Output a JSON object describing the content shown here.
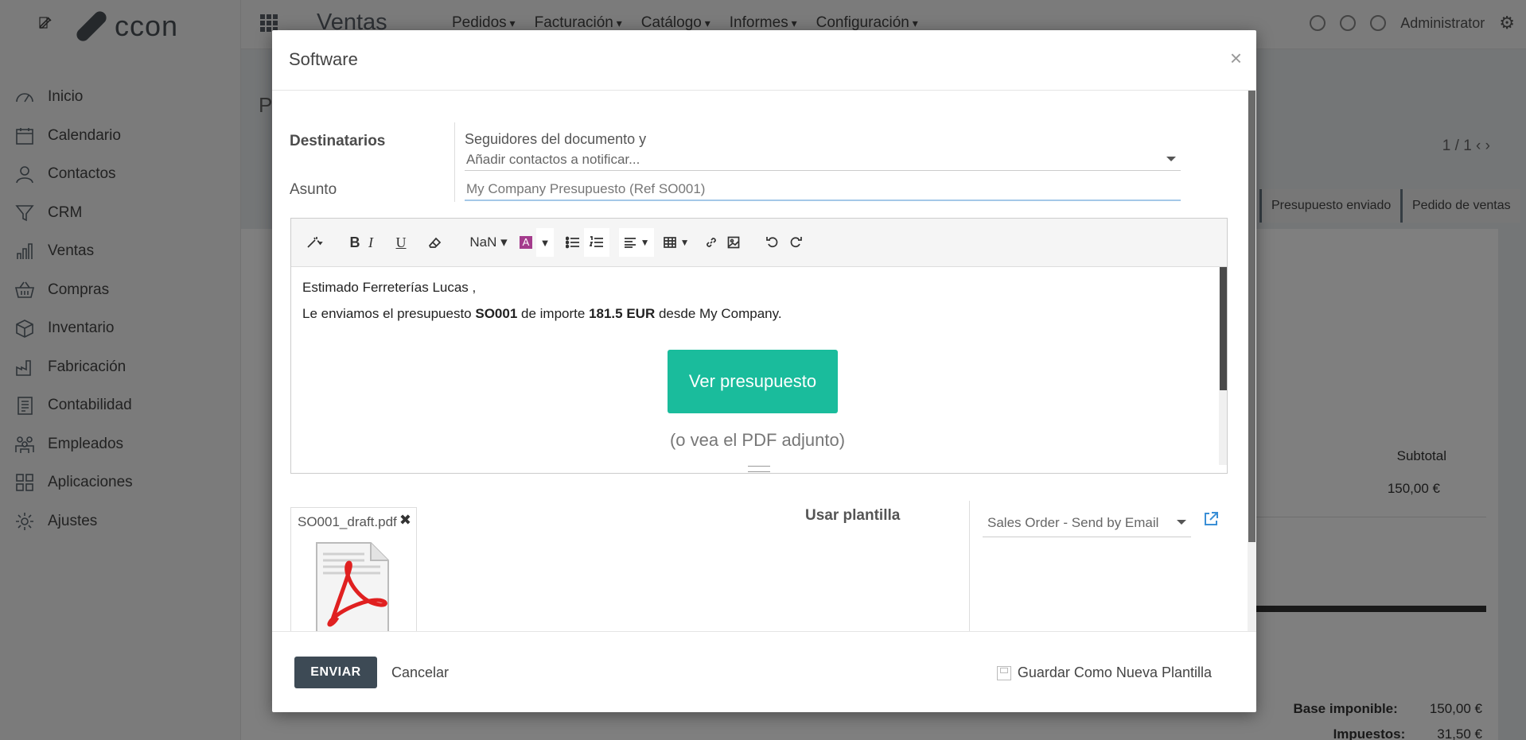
{
  "app": {
    "logo_text": "ccon",
    "module_title": "Ventas",
    "top_menu": [
      "Pedidos",
      "Facturación",
      "Catálogo",
      "Informes",
      "Configuración"
    ],
    "user": "Administrator"
  },
  "sidebar": {
    "items": [
      {
        "label": "Inicio",
        "icon": "dashboard-icon"
      },
      {
        "label": "Calendario",
        "icon": "calendar-icon"
      },
      {
        "label": "Contactos",
        "icon": "user-icon"
      },
      {
        "label": "CRM",
        "icon": "funnel-icon"
      },
      {
        "label": "Ventas",
        "icon": "bar-chart-icon"
      },
      {
        "label": "Compras",
        "icon": "basket-icon"
      },
      {
        "label": "Inventario",
        "icon": "box-icon"
      },
      {
        "label": "Fabricación",
        "icon": "factory-icon"
      },
      {
        "label": "Contabilidad",
        "icon": "ledger-icon"
      },
      {
        "label": "Empleados",
        "icon": "people-icon"
      },
      {
        "label": "Aplicaciones",
        "icon": "apps-icon"
      },
      {
        "label": "Ajustes",
        "icon": "gear-icon"
      }
    ]
  },
  "background": {
    "page_title_initial": "P",
    "pager": "1 / 1",
    "status_steps": [
      "Presupuesto enviado",
      "Pedido de ventas"
    ],
    "subtotal_header": "Subtotal",
    "line_subtotal": "150,00 €",
    "totals": [
      {
        "label": "Base imponible:",
        "value": "150,00 €"
      },
      {
        "label": "Impuestos:",
        "value": "31,50 €"
      }
    ]
  },
  "modal": {
    "title": "Software",
    "close_symbol": "×",
    "recipients_label": "Destinatarios",
    "recipients_static": "Seguidores del documento y",
    "recipients_placeholder": "Añadir contactos a notificar...",
    "subject_label": "Asunto",
    "subject_value": "My Company Presupuesto (Ref SO001)",
    "toolbar": {
      "font_size": "NaN"
    },
    "body": {
      "greeting": "Estimado Ferreterías Lucas ,",
      "line_prefix": "Le enviamos el presupuesto ",
      "order_ref": "SO001",
      "line_middle": " de importe ",
      "amount": "181.5 EUR",
      "line_suffix": " desde My Company.",
      "view_button": "Ver presupuesto",
      "pdf_note": "(o vea el PDF adjunto)"
    },
    "attachment": {
      "filename": "SO001_draft.pdf",
      "remove_symbol": "✖"
    },
    "template_label": "Usar plantilla",
    "template_value": "Sales Order - Send by Email",
    "footer": {
      "send": "ENVIAR",
      "cancel": "Cancelar",
      "save_template": "Guardar Como Nueva Plantilla"
    }
  },
  "colors": {
    "accent_button": "#1abc9c",
    "send_button": "#3d4a55",
    "subject_focus": "#a4c8e8"
  }
}
